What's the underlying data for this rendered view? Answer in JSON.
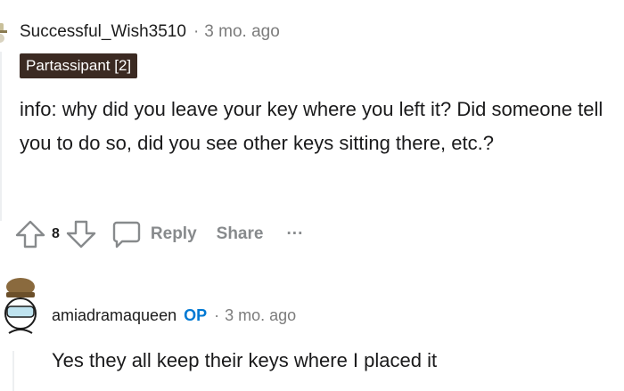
{
  "comment1": {
    "author": "Successful_Wish3510",
    "separator": "·",
    "time": "3 mo. ago",
    "flair": "Partassipant [2]",
    "body": "info: why did you leave your key where you left it? Did someone tell you to do so, did you see other keys sitting there, etc.?",
    "votes": "8",
    "reply_label": "Reply",
    "share_label": "Share",
    "more_label": "···"
  },
  "comment2": {
    "author": "amiadramaqueen",
    "op_badge": "OP",
    "separator": "·",
    "time": "3 mo. ago",
    "body": "Yes they all keep their keys where I placed it"
  },
  "colors": {
    "flair_bg": "#3b2a22",
    "op_badge": "#0079d3",
    "muted": "#878a8c",
    "thread_line": "#edeff1"
  }
}
